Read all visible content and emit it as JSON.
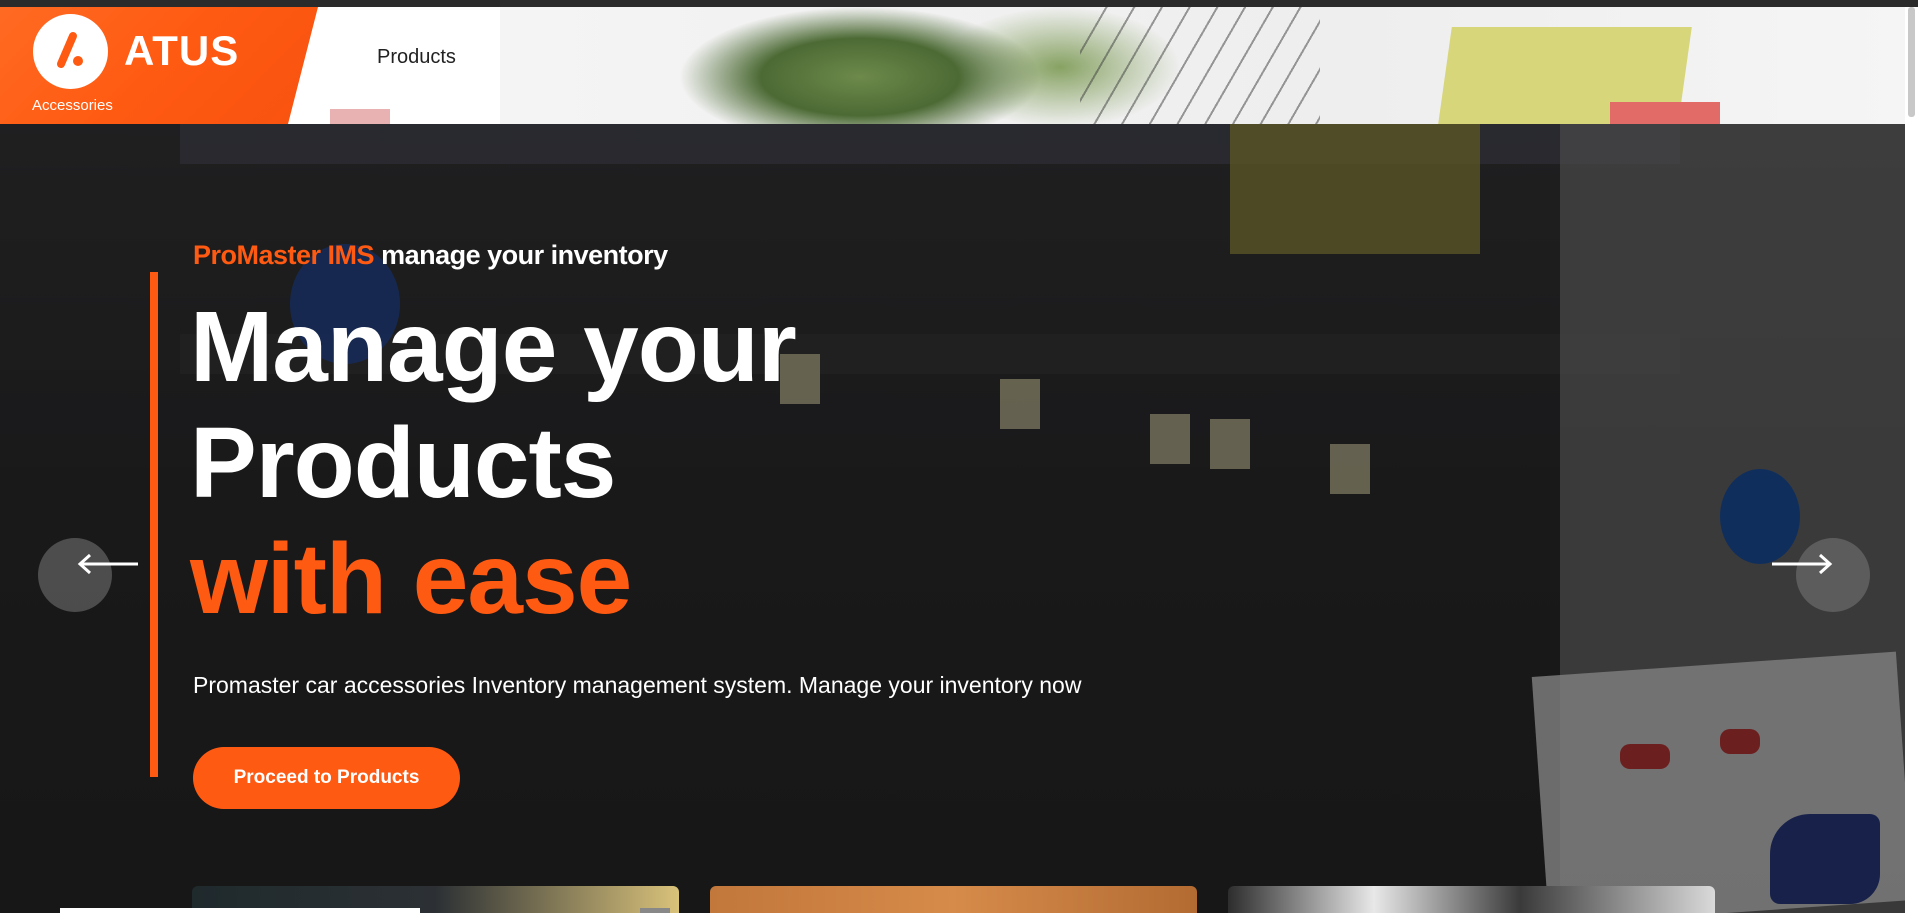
{
  "brand": {
    "logo_text": "ATUS",
    "logo_subtitle": "Accessories",
    "logo_icon": "brand-mark-icon",
    "accent_color": "#ff5a12"
  },
  "nav": {
    "products_label": "Products"
  },
  "hero": {
    "tagline_brand": "ProMaster IMS",
    "tagline_rest": " manage your inventory",
    "headline_line1": "Manage your",
    "headline_line2": "Products",
    "headline_line3": "with ease",
    "description": "Promaster car accessories Inventory management system. Manage your inventory now",
    "cta_label": "Proceed to Products",
    "prev_icon": "arrow-left-icon",
    "next_icon": "arrow-right-icon"
  }
}
